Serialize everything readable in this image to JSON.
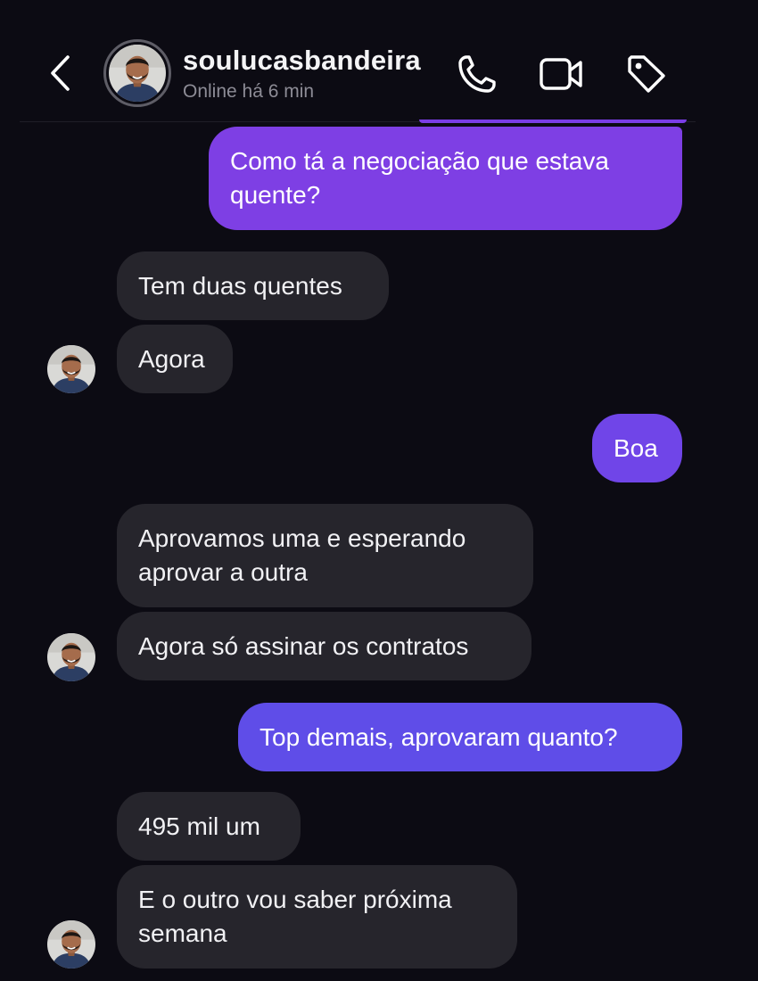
{
  "header": {
    "username": "soulucasbandeira",
    "status": "Online há 6 min"
  },
  "colors": {
    "background": "#0c0b13",
    "sent_bubble_1": "#7e3fe4",
    "sent_bubble_2": "#7045e8",
    "sent_bubble_3": "#5f4de8",
    "received_bubble": "#26252c"
  },
  "icons": {
    "back": "chevron-left-icon",
    "call": "phone-icon",
    "video": "video-camera-icon",
    "tag": "tag-icon"
  },
  "messages": [
    {
      "from": "me",
      "lines": [
        "Como tá a negociação que estava",
        "quente?"
      ]
    },
    {
      "from": "them",
      "lines": [
        "Tem duas quentes"
      ]
    },
    {
      "from": "them",
      "lines": [
        "Agora"
      ]
    },
    {
      "from": "me",
      "lines": [
        "Boa"
      ]
    },
    {
      "from": "them",
      "lines": [
        "Aprovamos uma e esperando",
        "aprovar a outra"
      ]
    },
    {
      "from": "them",
      "lines": [
        "Agora só assinar os contratos"
      ]
    },
    {
      "from": "me",
      "lines": [
        "Top demais, aprovaram quanto?"
      ]
    },
    {
      "from": "them",
      "lines": [
        "495 mil um"
      ]
    },
    {
      "from": "them",
      "lines": [
        "E o outro vou saber próxima",
        "semana"
      ]
    }
  ]
}
